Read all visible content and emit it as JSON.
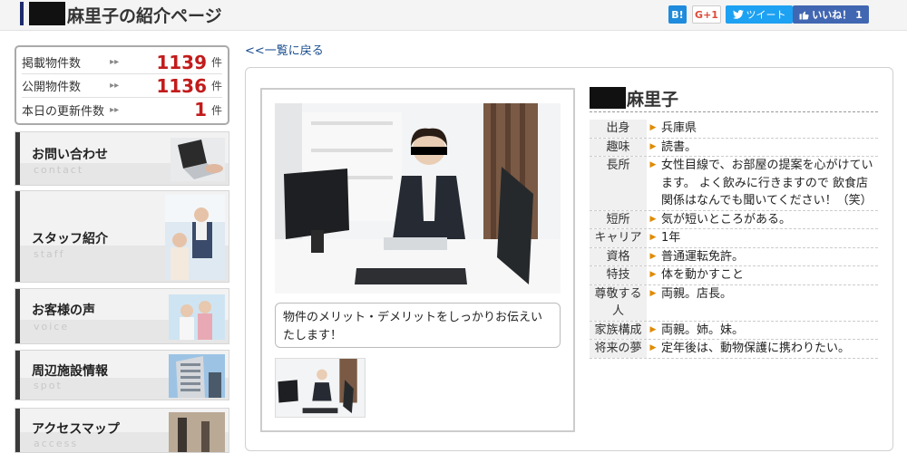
{
  "header": {
    "title": "麻里子の紹介ページ",
    "hatena_label": "B!",
    "gplus_label": "G+1",
    "tweet_label": "ツイート",
    "like_label": "いいね！ 1"
  },
  "stats": [
    {
      "label": "掲載物件数",
      "value": "1139",
      "unit": "件"
    },
    {
      "label": "公開物件数",
      "value": "1136",
      "unit": "件"
    },
    {
      "label": "本日の更新件数",
      "value": "1",
      "unit": "件"
    }
  ],
  "nav": [
    {
      "label": "お問い合わせ",
      "sub": "contact"
    },
    {
      "label": "スタッフ紹介",
      "sub": "staff"
    },
    {
      "label": "お客様の声",
      "sub": "voice"
    },
    {
      "label": "周辺施設情報",
      "sub": "spot"
    },
    {
      "label": "アクセスマップ",
      "sub": "access"
    }
  ],
  "back_link": "<<一覧に戻る",
  "caption": "物件のメリット・デメリットをしっかりお伝えいたします！",
  "staff_name": "麻里子",
  "profile": [
    {
      "key": "出身",
      "value": "兵庫県"
    },
    {
      "key": "趣味",
      "value": "読書。"
    },
    {
      "key": "長所",
      "value": "女性目線で、お部屋の提案を心がけています。 よく飲みに行きますので 飲食店関係はなんでも聞いてください！（笑）"
    },
    {
      "key": "短所",
      "value": "気が短いところがある。"
    },
    {
      "key": "キャリア",
      "value": "1年"
    },
    {
      "key": "資格",
      "value": "普通運転免許。"
    },
    {
      "key": "特技",
      "value": "体を動かすこと"
    },
    {
      "key": "尊敬する人",
      "value": "両親。店長。"
    },
    {
      "key": "家族構成",
      "value": "両親。姉。妹。"
    },
    {
      "key": "将来の夢",
      "value": "定年後は、動物保護に携わりたい。"
    }
  ],
  "colors": {
    "accent_red": "#c21b1b",
    "title_bar": "#1d2b6b",
    "arrow_orange": "#e08a00"
  },
  "icons": [
    "hatena-bookmark-icon",
    "twitter-bird-icon",
    "facebook-thumb-icon",
    "double-arrow-icon",
    "triangle-bullet-icon"
  ]
}
